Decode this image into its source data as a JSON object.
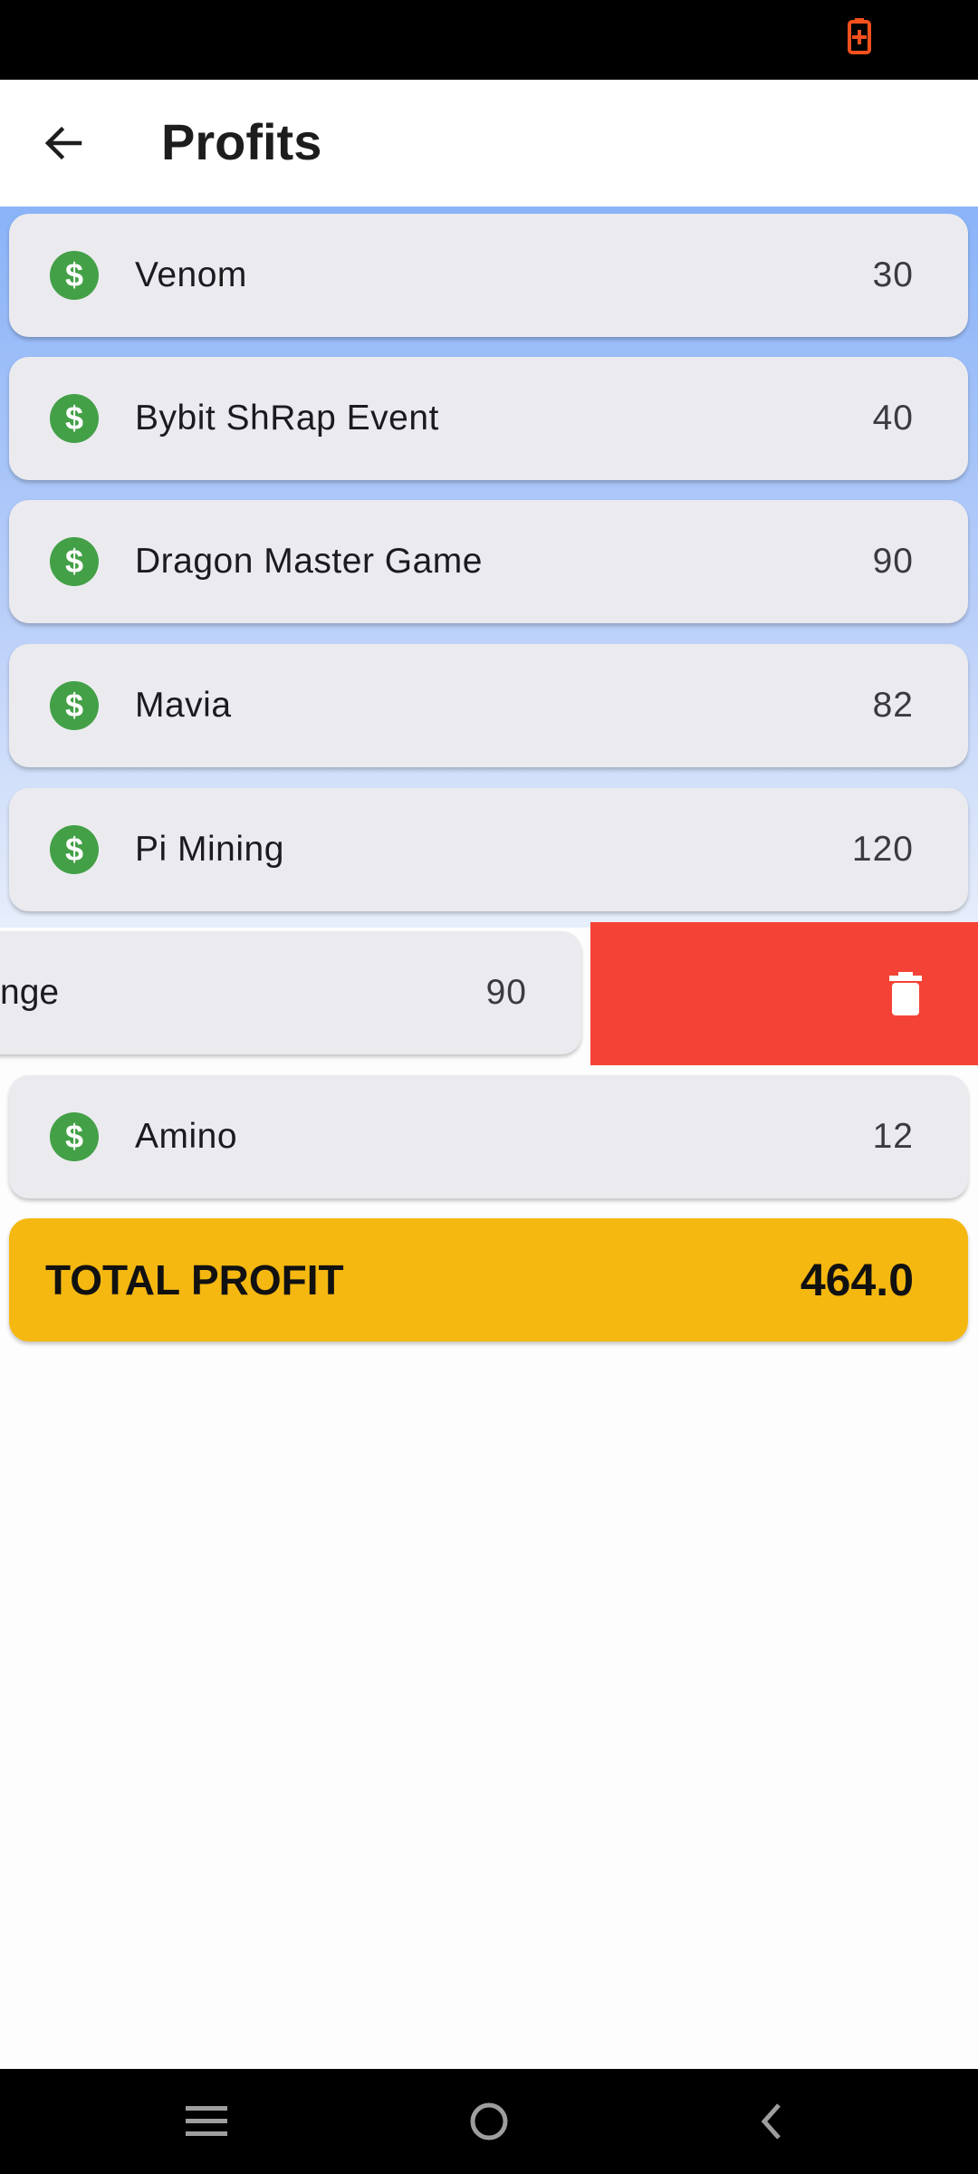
{
  "status_bar": {
    "battery_icon": "battery-charging-icon",
    "battery_color": "#f4511e"
  },
  "app_bar": {
    "back_icon": "arrow-back-icon",
    "title": "Profits"
  },
  "profits": [
    {
      "icon": "dollar-icon",
      "name": "Venom",
      "value": "30"
    },
    {
      "icon": "dollar-icon",
      "name": "Bybit ShRap Event",
      "value": "40"
    },
    {
      "icon": "dollar-icon",
      "name": "Dragon Master Game",
      "value": "90"
    },
    {
      "icon": "dollar-icon",
      "name": "Mavia",
      "value": "82"
    },
    {
      "icon": "dollar-icon",
      "name": "Pi Mining",
      "value": "120"
    }
  ],
  "swiped_item": {
    "name_fragment": "nge",
    "value": "90",
    "action_icon": "trash-icon",
    "action_color": "#f44336"
  },
  "last_item": {
    "icon": "dollar-icon",
    "name": "Amino",
    "value": "12"
  },
  "total": {
    "label": "TOTAL PROFIT",
    "value": "464.0",
    "color": "#f5b811"
  },
  "nav_bar": {
    "menu_icon": "menu-icon",
    "home_icon": "home-icon",
    "back_icon": "back-icon"
  },
  "colors": {
    "accent_green": "#43a047",
    "card_bg": "#ebebef"
  }
}
